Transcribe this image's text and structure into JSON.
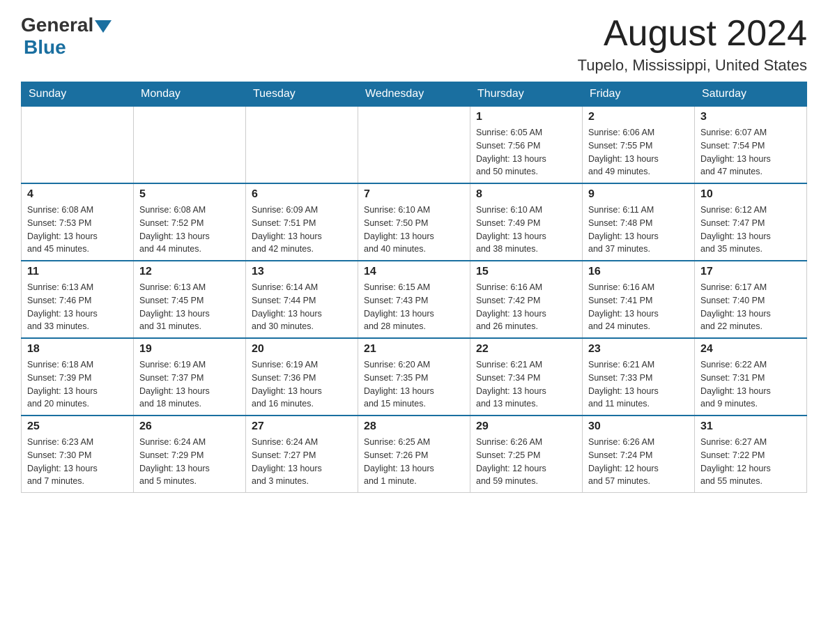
{
  "header": {
    "logo_general": "General",
    "logo_blue": "Blue",
    "month_title": "August 2024",
    "location": "Tupelo, Mississippi, United States"
  },
  "weekdays": [
    "Sunday",
    "Monday",
    "Tuesday",
    "Wednesday",
    "Thursday",
    "Friday",
    "Saturday"
  ],
  "weeks": [
    [
      {
        "day": "",
        "info": ""
      },
      {
        "day": "",
        "info": ""
      },
      {
        "day": "",
        "info": ""
      },
      {
        "day": "",
        "info": ""
      },
      {
        "day": "1",
        "info": "Sunrise: 6:05 AM\nSunset: 7:56 PM\nDaylight: 13 hours\nand 50 minutes."
      },
      {
        "day": "2",
        "info": "Sunrise: 6:06 AM\nSunset: 7:55 PM\nDaylight: 13 hours\nand 49 minutes."
      },
      {
        "day": "3",
        "info": "Sunrise: 6:07 AM\nSunset: 7:54 PM\nDaylight: 13 hours\nand 47 minutes."
      }
    ],
    [
      {
        "day": "4",
        "info": "Sunrise: 6:08 AM\nSunset: 7:53 PM\nDaylight: 13 hours\nand 45 minutes."
      },
      {
        "day": "5",
        "info": "Sunrise: 6:08 AM\nSunset: 7:52 PM\nDaylight: 13 hours\nand 44 minutes."
      },
      {
        "day": "6",
        "info": "Sunrise: 6:09 AM\nSunset: 7:51 PM\nDaylight: 13 hours\nand 42 minutes."
      },
      {
        "day": "7",
        "info": "Sunrise: 6:10 AM\nSunset: 7:50 PM\nDaylight: 13 hours\nand 40 minutes."
      },
      {
        "day": "8",
        "info": "Sunrise: 6:10 AM\nSunset: 7:49 PM\nDaylight: 13 hours\nand 38 minutes."
      },
      {
        "day": "9",
        "info": "Sunrise: 6:11 AM\nSunset: 7:48 PM\nDaylight: 13 hours\nand 37 minutes."
      },
      {
        "day": "10",
        "info": "Sunrise: 6:12 AM\nSunset: 7:47 PM\nDaylight: 13 hours\nand 35 minutes."
      }
    ],
    [
      {
        "day": "11",
        "info": "Sunrise: 6:13 AM\nSunset: 7:46 PM\nDaylight: 13 hours\nand 33 minutes."
      },
      {
        "day": "12",
        "info": "Sunrise: 6:13 AM\nSunset: 7:45 PM\nDaylight: 13 hours\nand 31 minutes."
      },
      {
        "day": "13",
        "info": "Sunrise: 6:14 AM\nSunset: 7:44 PM\nDaylight: 13 hours\nand 30 minutes."
      },
      {
        "day": "14",
        "info": "Sunrise: 6:15 AM\nSunset: 7:43 PM\nDaylight: 13 hours\nand 28 minutes."
      },
      {
        "day": "15",
        "info": "Sunrise: 6:16 AM\nSunset: 7:42 PM\nDaylight: 13 hours\nand 26 minutes."
      },
      {
        "day": "16",
        "info": "Sunrise: 6:16 AM\nSunset: 7:41 PM\nDaylight: 13 hours\nand 24 minutes."
      },
      {
        "day": "17",
        "info": "Sunrise: 6:17 AM\nSunset: 7:40 PM\nDaylight: 13 hours\nand 22 minutes."
      }
    ],
    [
      {
        "day": "18",
        "info": "Sunrise: 6:18 AM\nSunset: 7:39 PM\nDaylight: 13 hours\nand 20 minutes."
      },
      {
        "day": "19",
        "info": "Sunrise: 6:19 AM\nSunset: 7:37 PM\nDaylight: 13 hours\nand 18 minutes."
      },
      {
        "day": "20",
        "info": "Sunrise: 6:19 AM\nSunset: 7:36 PM\nDaylight: 13 hours\nand 16 minutes."
      },
      {
        "day": "21",
        "info": "Sunrise: 6:20 AM\nSunset: 7:35 PM\nDaylight: 13 hours\nand 15 minutes."
      },
      {
        "day": "22",
        "info": "Sunrise: 6:21 AM\nSunset: 7:34 PM\nDaylight: 13 hours\nand 13 minutes."
      },
      {
        "day": "23",
        "info": "Sunrise: 6:21 AM\nSunset: 7:33 PM\nDaylight: 13 hours\nand 11 minutes."
      },
      {
        "day": "24",
        "info": "Sunrise: 6:22 AM\nSunset: 7:31 PM\nDaylight: 13 hours\nand 9 minutes."
      }
    ],
    [
      {
        "day": "25",
        "info": "Sunrise: 6:23 AM\nSunset: 7:30 PM\nDaylight: 13 hours\nand 7 minutes."
      },
      {
        "day": "26",
        "info": "Sunrise: 6:24 AM\nSunset: 7:29 PM\nDaylight: 13 hours\nand 5 minutes."
      },
      {
        "day": "27",
        "info": "Sunrise: 6:24 AM\nSunset: 7:27 PM\nDaylight: 13 hours\nand 3 minutes."
      },
      {
        "day": "28",
        "info": "Sunrise: 6:25 AM\nSunset: 7:26 PM\nDaylight: 13 hours\nand 1 minute."
      },
      {
        "day": "29",
        "info": "Sunrise: 6:26 AM\nSunset: 7:25 PM\nDaylight: 12 hours\nand 59 minutes."
      },
      {
        "day": "30",
        "info": "Sunrise: 6:26 AM\nSunset: 7:24 PM\nDaylight: 12 hours\nand 57 minutes."
      },
      {
        "day": "31",
        "info": "Sunrise: 6:27 AM\nSunset: 7:22 PM\nDaylight: 12 hours\nand 55 minutes."
      }
    ]
  ]
}
